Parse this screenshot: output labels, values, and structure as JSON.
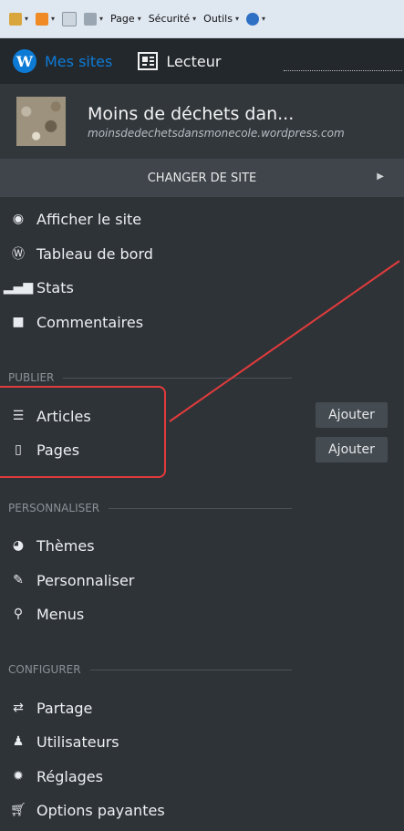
{
  "ie_toolbar": {
    "items": [
      "Page",
      "Sécurité",
      "Outils"
    ]
  },
  "wp_top": {
    "mes_sites": "Mes sites",
    "lecteur": "Lecteur"
  },
  "site": {
    "name": "Moins de déchets dan...",
    "url": "moinsdedechetsdansmonecole.wordpress.com"
  },
  "change_site": "CHANGER DE SITE",
  "menu": {
    "main": [
      {
        "label": "Afficher le site",
        "icon": "globe-icon"
      },
      {
        "label": "Tableau de bord",
        "icon": "wordpress-icon"
      },
      {
        "label": "Stats",
        "icon": "stats-icon"
      },
      {
        "label": "Commentaires",
        "icon": "comment-icon"
      }
    ],
    "publier": {
      "title": "PUBLIER",
      "items": [
        {
          "label": "Articles",
          "icon": "articles-icon",
          "add": "Ajouter"
        },
        {
          "label": "Pages",
          "icon": "page-icon",
          "add": "Ajouter"
        }
      ]
    },
    "personnaliser": {
      "title": "PERSONNALISER",
      "items": [
        {
          "label": "Thèmes",
          "icon": "themes-icon"
        },
        {
          "label": "Personnaliser",
          "icon": "brush-icon"
        },
        {
          "label": "Menus",
          "icon": "pin-icon"
        }
      ]
    },
    "configurer": {
      "title": "CONFIGURER",
      "items": [
        {
          "label": "Partage",
          "icon": "share-icon"
        },
        {
          "label": "Utilisateurs",
          "icon": "user-icon"
        },
        {
          "label": "Réglages",
          "icon": "settings-icon"
        },
        {
          "label": "Options payantes",
          "icon": "cart-icon"
        }
      ]
    }
  },
  "colors": {
    "annotation": "#e23b3b",
    "wp_blue": "#0d7bd6",
    "sidebar_bg": "#2e3338"
  }
}
